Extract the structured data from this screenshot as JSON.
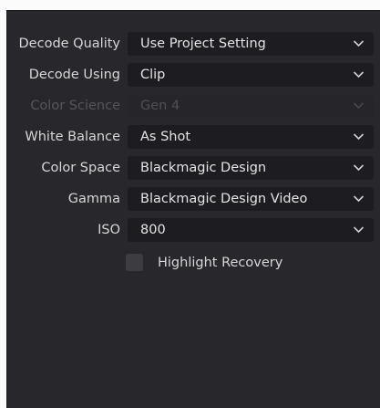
{
  "fields": [
    {
      "label": "Decode Quality",
      "value": "Use Project Setting",
      "disabled": false
    },
    {
      "label": "Decode Using",
      "value": "Clip",
      "disabled": false
    },
    {
      "label": "Color Science",
      "value": "Gen 4",
      "disabled": true
    },
    {
      "label": "White Balance",
      "value": "As Shot",
      "disabled": false
    },
    {
      "label": "Color Space",
      "value": "Blackmagic Design",
      "disabled": false
    },
    {
      "label": "Gamma",
      "value": "Blackmagic Design Video",
      "disabled": false
    },
    {
      "label": "ISO",
      "value": "800",
      "disabled": false
    }
  ],
  "highlight_recovery": {
    "label": "Highlight Recovery",
    "checked": false
  },
  "icons": {
    "dropdown": "chevron-down-icon"
  },
  "colors": {
    "panel": "#28282c",
    "field": "#1d1d21",
    "text": "#d6d6d8",
    "disabled_text": "#55555a"
  }
}
